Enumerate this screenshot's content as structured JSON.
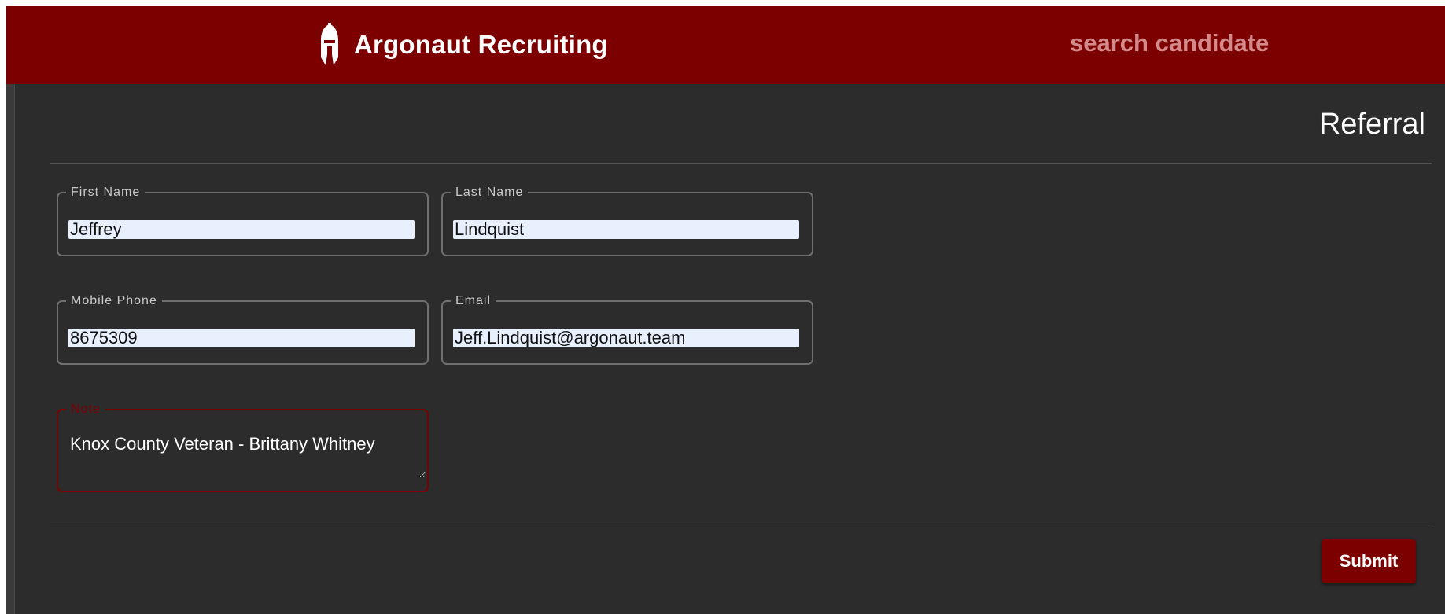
{
  "app": {
    "title": "Argonaut Recruiting",
    "logo_icon": "spartan-helmet-icon",
    "search_placeholder": "search candidate"
  },
  "page": {
    "title": "Referral"
  },
  "form": {
    "first_name": {
      "label": "First Name",
      "value": "Jeffrey"
    },
    "last_name": {
      "label": "Last Name",
      "value": "Lindquist"
    },
    "mobile_phone": {
      "label": "Mobile Phone",
      "value": "8675309"
    },
    "email": {
      "label": "Email",
      "value": "Jeff.Lindquist@argonaut.team"
    },
    "note": {
      "label": "Note",
      "value": "Knox County Veteran - Brittany Whitney"
    },
    "submit_label": "Submit"
  },
  "colors": {
    "brand": "#7d0000",
    "background": "#2c2c2c",
    "autofill": "#e8f0fe"
  }
}
